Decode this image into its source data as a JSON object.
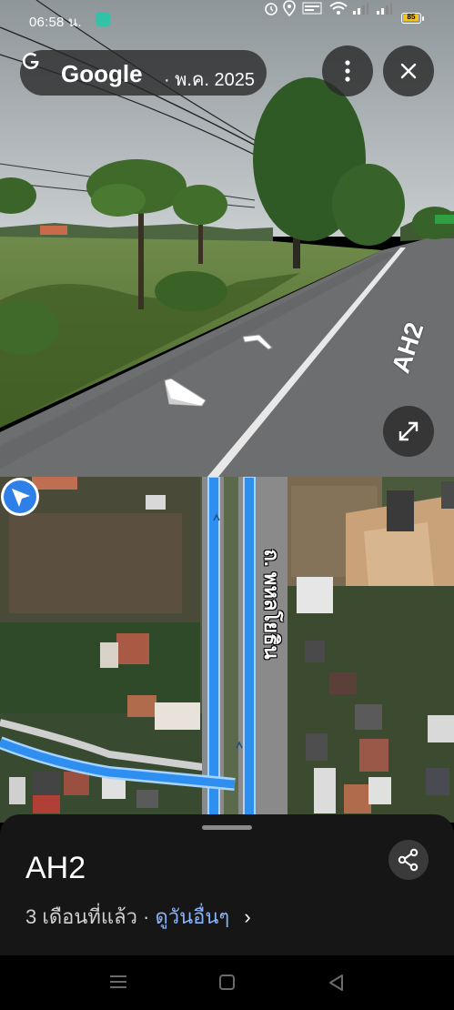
{
  "status_bar": {
    "time": "06:58 น.",
    "battery_level": "85",
    "icons": [
      "alarm-icon",
      "location-icon",
      "data-speed-icon",
      "wifi-icon",
      "signal-icon",
      "signal-icon",
      "battery-icon"
    ]
  },
  "street_view": {
    "brand": "Google",
    "date": "· พ.ค. 2025",
    "road_label": "AH2",
    "buttons": [
      "more-options",
      "close",
      "expand"
    ]
  },
  "map": {
    "road_name": "ถ. พหลโยธิน"
  },
  "sheet": {
    "title": "AH2",
    "time_ago": "3 เดือนที่แล้ว · ",
    "see_more": "ดูวันอื่นๆ",
    "chevron": "›"
  },
  "colors": {
    "accent_link": "#8ab4f8",
    "route_line": "#2f8ff0",
    "battery": "#f4c21f"
  }
}
